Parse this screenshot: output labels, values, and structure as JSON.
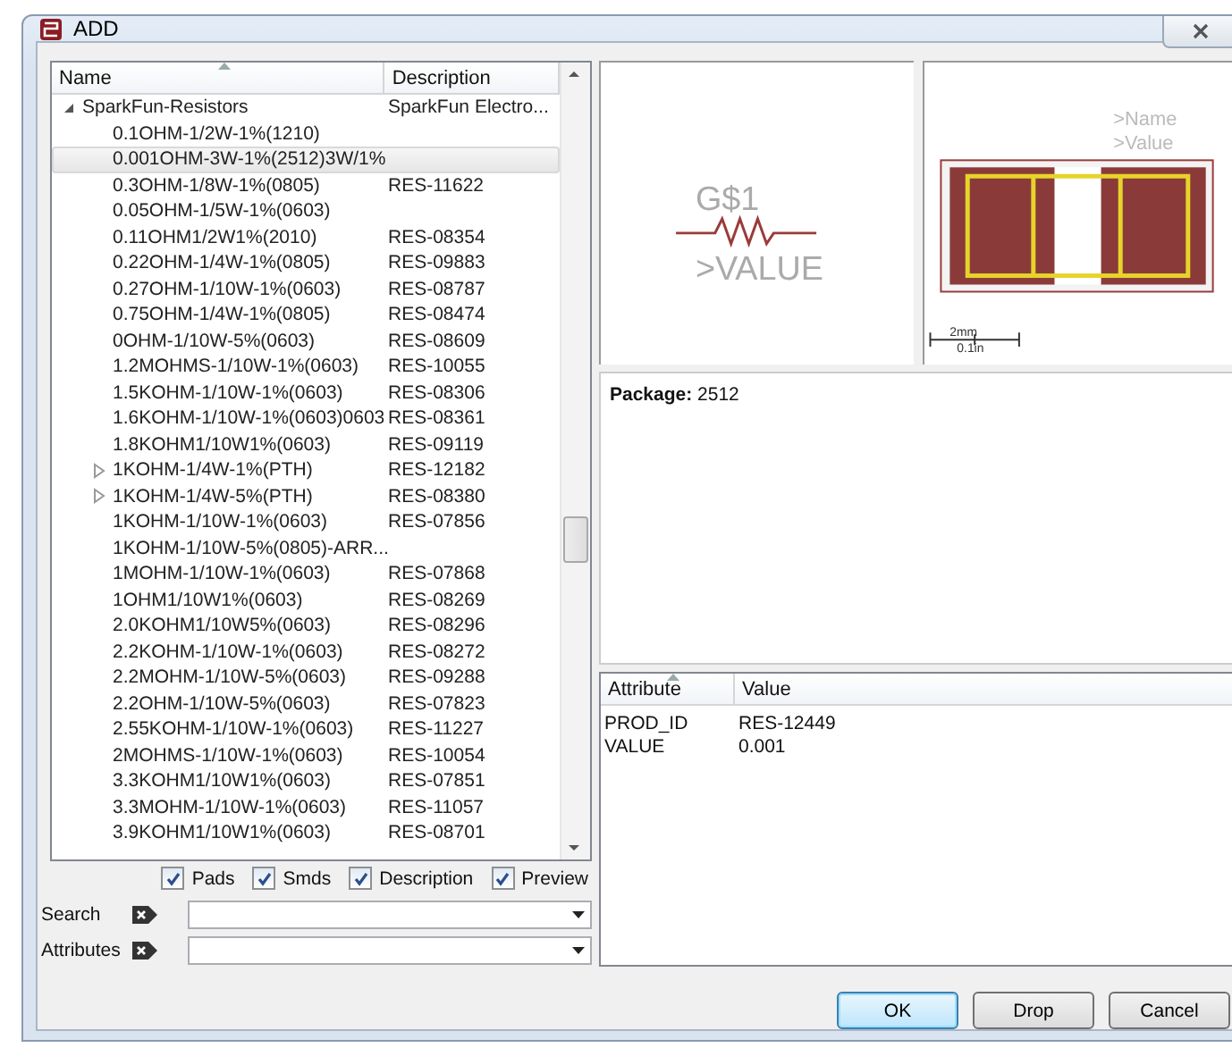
{
  "window": {
    "title": "ADD"
  },
  "tree": {
    "columns": [
      "Name",
      "Description"
    ],
    "items": [
      {
        "name": "SparkFun-Resistors",
        "description": "SparkFun Electro...",
        "kind": "group",
        "expanded": true,
        "selected": false,
        "children": [
          {
            "name": "0.1OHM-1/2W-1%(1210)",
            "kind": "leaf",
            "selected": false
          },
          {
            "name": "0.001OHM-3W-1%(2512)3W/1%",
            "kind": "leaf",
            "selected": true
          },
          {
            "name": "0.3OHM-1/8W-1%(0805)",
            "description": "RES-11622",
            "kind": "leaf",
            "selected": false
          },
          {
            "name": "0.05OHM-1/5W-1%(0603)",
            "kind": "leaf",
            "selected": false
          },
          {
            "name": "0.11OHM1/2W1%(2010)",
            "description": "RES-08354",
            "kind": "leaf",
            "selected": false
          },
          {
            "name": "0.22OHM-1/4W-1%(0805)",
            "description": "RES-09883",
            "kind": "leaf",
            "selected": false
          },
          {
            "name": "0.27OHM-1/10W-1%(0603)",
            "description": "RES-08787",
            "kind": "leaf",
            "selected": false
          },
          {
            "name": "0.75OHM-1/4W-1%(0805)",
            "description": "RES-08474",
            "kind": "leaf",
            "selected": false
          },
          {
            "name": "0OHM-1/10W-5%(0603)",
            "description": "RES-08609",
            "kind": "leaf",
            "selected": false
          },
          {
            "name": "1.2MOHMS-1/10W-1%(0603)",
            "description": "RES-10055",
            "kind": "leaf",
            "selected": false
          },
          {
            "name": "1.5KOHM-1/10W-1%(0603)",
            "description": "RES-08306",
            "kind": "leaf",
            "selected": false
          },
          {
            "name": "1.6KOHM-1/10W-1%(0603)0603",
            "description": "RES-08361",
            "kind": "leaf",
            "selected": false
          },
          {
            "name": "1.8KOHM1/10W1%(0603)",
            "description": "RES-09119",
            "kind": "leaf",
            "selected": false
          },
          {
            "name": "1KOHM-1/4W-1%(PTH)",
            "description": "RES-12182",
            "kind": "group",
            "expanded": false,
            "selected": false
          },
          {
            "name": "1KOHM-1/4W-5%(PTH)",
            "description": "RES-08380",
            "kind": "group",
            "expanded": false,
            "selected": false
          },
          {
            "name": "1KOHM-1/10W-1%(0603)",
            "description": "RES-07856",
            "kind": "leaf",
            "selected": false
          },
          {
            "name": "1KOHM-1/10W-5%(0805)-ARR...",
            "kind": "leaf",
            "selected": false
          },
          {
            "name": "1MOHM-1/10W-1%(0603)",
            "description": "RES-07868",
            "kind": "leaf",
            "selected": false
          },
          {
            "name": "1OHM1/10W1%(0603)",
            "description": "RES-08269",
            "kind": "leaf",
            "selected": false
          },
          {
            "name": "2.0KOHM1/10W5%(0603)",
            "description": "RES-08296",
            "kind": "leaf",
            "selected": false
          },
          {
            "name": "2.2KOHM-1/10W-1%(0603)",
            "description": "RES-08272",
            "kind": "leaf",
            "selected": false
          },
          {
            "name": "2.2MOHM-1/10W-5%(0603)",
            "description": "RES-09288",
            "kind": "leaf",
            "selected": false
          },
          {
            "name": "2.2OHM-1/10W-5%(0603)",
            "description": "RES-07823",
            "kind": "leaf",
            "selected": false
          },
          {
            "name": "2.55KOHM-1/10W-1%(0603)",
            "description": "RES-11227",
            "kind": "leaf",
            "selected": false
          },
          {
            "name": "2MOHMS-1/10W-1%(0603)",
            "description": "RES-10054",
            "kind": "leaf",
            "selected": false
          },
          {
            "name": "3.3KOHM1/10W1%(0603)",
            "description": "RES-07851",
            "kind": "leaf",
            "selected": false
          },
          {
            "name": "3.3MOHM-1/10W-1%(0603)",
            "description": "RES-11057",
            "kind": "leaf",
            "selected": false
          },
          {
            "name": "3.9KOHM1/10W1%(0603)",
            "description": "RES-08701",
            "kind": "leaf",
            "selected": false
          }
        ]
      }
    ]
  },
  "options": [
    {
      "label": "Pads",
      "checked": true
    },
    {
      "label": "Smds",
      "checked": true
    },
    {
      "label": "Description",
      "checked": true
    },
    {
      "label": "Preview",
      "checked": true
    }
  ],
  "filters": [
    {
      "label": "Search"
    },
    {
      "label": "Attributes"
    }
  ],
  "symbol_preview": {
    "name": "G$1",
    "value": ">VALUE"
  },
  "package_preview": {
    "name": ">Name",
    "value": ">Value",
    "scale_top": "2mm",
    "scale_bottom": "0.1in"
  },
  "package_info": "**Package:** 2512",
  "attributes": {
    "columns": [
      "Attribute",
      "Value"
    ],
    "rows": [
      {
        "attribute": "PROD_ID",
        "value": "RES-12449"
      },
      {
        "attribute": "VALUE",
        "value": "0.001"
      }
    ]
  },
  "buttons": [
    {
      "label": "OK",
      "default": true
    },
    {
      "label": "Drop",
      "default": false
    },
    {
      "label": "Cancel",
      "default": false
    }
  ]
}
